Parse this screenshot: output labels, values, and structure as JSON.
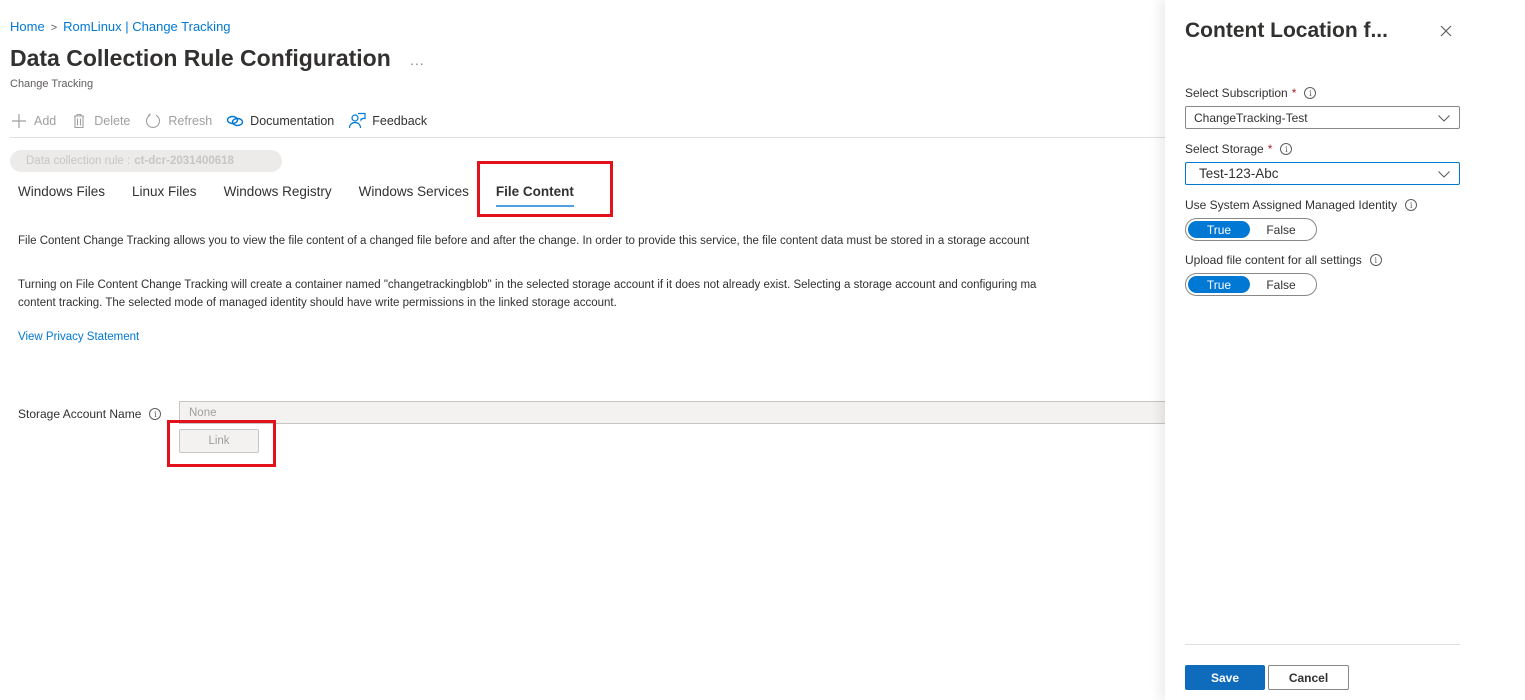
{
  "breadcrumb": {
    "home": "Home",
    "separator": ">",
    "current": "RomLinux | Change Tracking"
  },
  "header": {
    "title": "Data Collection Rule Configuration",
    "more": "...",
    "subtitle": "Change Tracking"
  },
  "toolbar": {
    "add": {
      "label": "Add",
      "icon": "plus-icon",
      "enabled": false
    },
    "delete": {
      "label": "Delete",
      "icon": "trash-icon",
      "enabled": false
    },
    "refresh": {
      "label": "Refresh",
      "icon": "refresh-icon",
      "enabled": false
    },
    "documentation": {
      "label": "Documentation",
      "icon": "link-icon",
      "enabled": true
    },
    "feedback": {
      "label": "Feedback",
      "icon": "feedback-icon",
      "enabled": true
    }
  },
  "rule": {
    "label": "Data collection rule :",
    "name": "ct-dcr-2031400618"
  },
  "tabs": [
    {
      "label": "Windows Files",
      "active": false
    },
    {
      "label": "Linux Files",
      "active": false
    },
    {
      "label": "Windows Registry",
      "active": false
    },
    {
      "label": "Windows Services",
      "active": false
    },
    {
      "label": "File Content",
      "active": true
    }
  ],
  "content": {
    "para1": "File Content Change Tracking allows you to view the file content of a changed file before and after the change. In order to provide this service, the file content data must be stored in a storage account",
    "para2_line1": "Turning on File Content Change Tracking will create a container named \"changetrackingblob\" in the selected storage account if it does not already exist. Selecting a storage account and configuring ma",
    "para2_line2": "content tracking. The selected mode of managed identity should have write permissions in the linked storage account.",
    "privacy_link": "View Privacy Statement",
    "storage_label": "Storage Account Name",
    "storage_value": "None",
    "link_button": "Link"
  },
  "panel": {
    "title": "Content Location f...",
    "close_icon": "close-icon",
    "subscription": {
      "label": "Select Subscription",
      "required": "*",
      "value": "ChangeTracking-Test"
    },
    "storage": {
      "label": "Select Storage",
      "required": "*",
      "value": "Test-123-Abc"
    },
    "managed_identity": {
      "label": "Use System Assigned Managed Identity",
      "true_label": "True",
      "false_label": "False",
      "value": true
    },
    "upload_all": {
      "label": "Upload file content for all settings",
      "true_label": "True",
      "false_label": "False",
      "value": true
    },
    "save": "Save",
    "cancel": "Cancel"
  },
  "colors": {
    "accent": "#0078d4",
    "highlight": "#e3111b",
    "save_button": "#0f6cbd"
  }
}
